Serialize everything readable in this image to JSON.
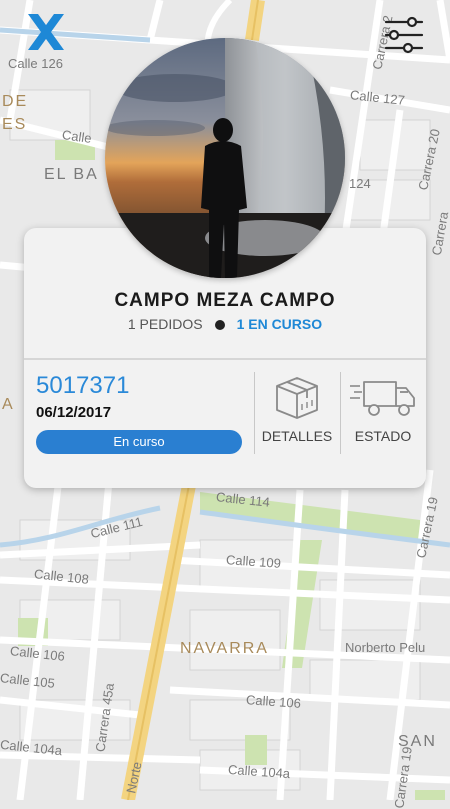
{
  "app": {
    "logo_icon": "x-logo-icon",
    "filter_icon": "sliders-icon",
    "brand_color": "#1e88d6"
  },
  "map": {
    "labels": [
      "Calle 126",
      "Carrera 20",
      "Carrera 2",
      "Calle 127",
      "Calle",
      "EL BA",
      "DE",
      "ES",
      "124",
      "Carrera",
      "A",
      "Calle 114",
      "Calle 111",
      "Calle 109",
      "Calle 108",
      "Calle 106",
      "Calle 105",
      "NAVARRA",
      "Norberto Pelu",
      "Calle 106",
      "SAN",
      "Carrera 45a",
      "Calle 104a",
      "Calle 104a",
      "Carrera 19",
      "Carrera 19",
      "Norte"
    ]
  },
  "profile": {
    "name": "CAMPO MEZA CAMPO",
    "orders_count": "1 PEDIDOS",
    "active_count": "1 EN CURSO"
  },
  "order": {
    "id": "5017371",
    "date": "06/12/2017",
    "status": "En curso",
    "details_label": "DETALLES",
    "state_label": "ESTADO"
  }
}
